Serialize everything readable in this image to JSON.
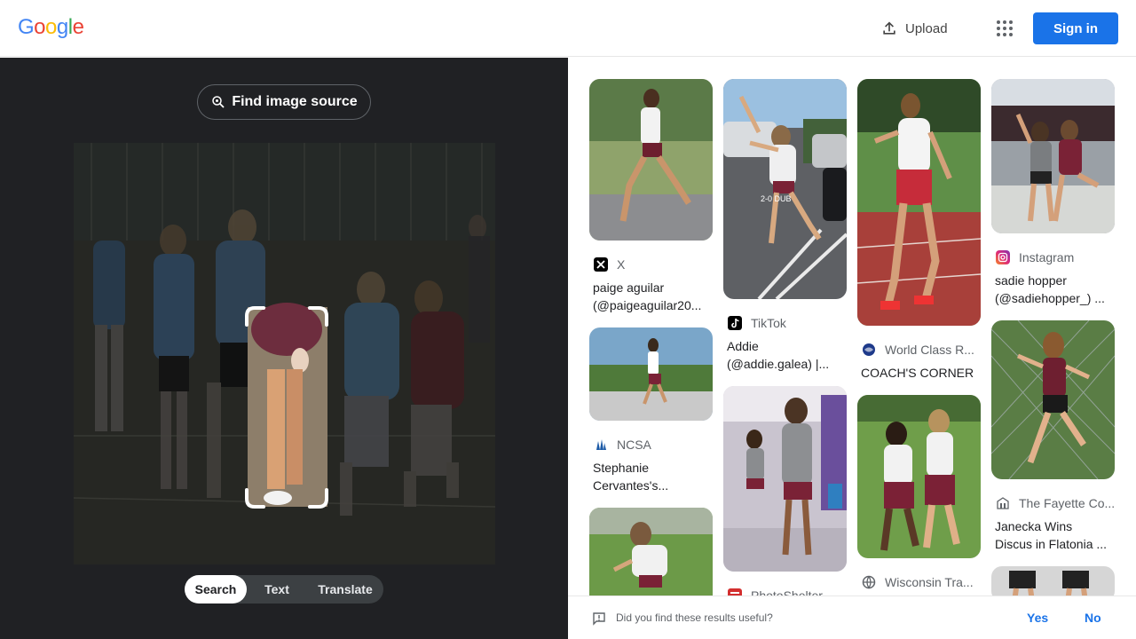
{
  "header": {
    "logo_letters": [
      "G",
      "o",
      "o",
      "g",
      "l",
      "e"
    ],
    "logo_colors": [
      "#4285f4",
      "#ea4335",
      "#fbbc05",
      "#4285f4",
      "#34a853",
      "#ea4335"
    ],
    "upload_label": "Upload",
    "apps_icon": "apps-grid-icon",
    "signin_label": "Sign in"
  },
  "left": {
    "find_source_label": "Find image source",
    "tabs": [
      {
        "label": "Search",
        "active": true
      },
      {
        "label": "Text",
        "active": false
      },
      {
        "label": "Translate",
        "active": false
      }
    ]
  },
  "results": [
    {
      "source": "X",
      "title": "paige aguilar (@paigeaguilar20...",
      "icon": "x-logo-icon"
    },
    {
      "source": "NCSA",
      "title": "Stephanie Cervantes's...",
      "icon": "ncsa-icon"
    },
    {
      "source": "",
      "title": "",
      "icon": ""
    },
    {
      "source": "TikTok",
      "title": "Addie (@addie.galea) |...",
      "icon": "tiktok-icon"
    },
    {
      "source": "PhotoShelter",
      "title": "",
      "icon": "photoshelter-icon"
    },
    {
      "source": "World Class R...",
      "title": "COACH'S CORNER",
      "icon": "globe-icon"
    },
    {
      "source": "Wisconsin Tra...",
      "title": "",
      "icon": "globe-icon"
    },
    {
      "source": "Instagram",
      "title": "sadie hopper (@sadiehopper_) ...",
      "icon": "instagram-icon"
    },
    {
      "source": "The Fayette Co...",
      "title": "Janecka Wins Discus in Flatonia ...",
      "icon": "building-icon"
    },
    {
      "source": "",
      "title": "",
      "icon": ""
    }
  ],
  "feedback": {
    "question": "Did you find these results useful?",
    "yes_label": "Yes",
    "no_label": "No"
  },
  "colors": {
    "accent": "#1a73e8",
    "left_panel_bg": "#202124"
  }
}
